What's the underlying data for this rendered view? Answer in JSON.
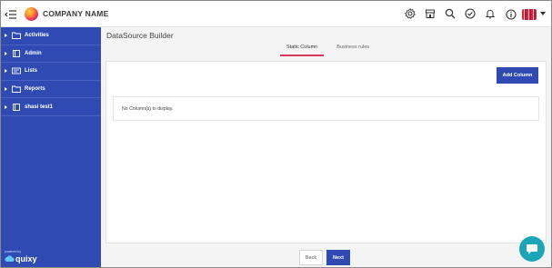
{
  "header": {
    "company_name": "COMPANY NAME",
    "icons": [
      "settings-icon",
      "store-icon",
      "search-icon",
      "check-circle-icon",
      "bell-icon"
    ],
    "info_icon": "info-icon",
    "menu_icon": "menu-collapse-icon"
  },
  "sidebar": {
    "items": [
      {
        "label": "Activities",
        "icon": "folder-icon"
      },
      {
        "label": "Admin",
        "icon": "book-icon"
      },
      {
        "label": "Lists",
        "icon": "list-card-icon"
      },
      {
        "label": "Reports",
        "icon": "folder-icon"
      },
      {
        "label": "shasi test1",
        "icon": "book-icon"
      }
    ],
    "powered_by": "powered by",
    "brand": "quixy"
  },
  "main": {
    "title": "DataSource Builder",
    "tabs": [
      {
        "label": "Static Column",
        "active": true
      },
      {
        "label": "Business rules",
        "active": false
      }
    ],
    "add_column_label": "Add Column",
    "empty_message": "No Column(s) to display.",
    "back_label": "Back",
    "next_label": "Next"
  },
  "colors": {
    "sidebar": "#2f4bb3",
    "primary_button": "#2f4bb3",
    "tab_underline": "#d9345e",
    "chat_bubble": "#1aa6b7"
  }
}
